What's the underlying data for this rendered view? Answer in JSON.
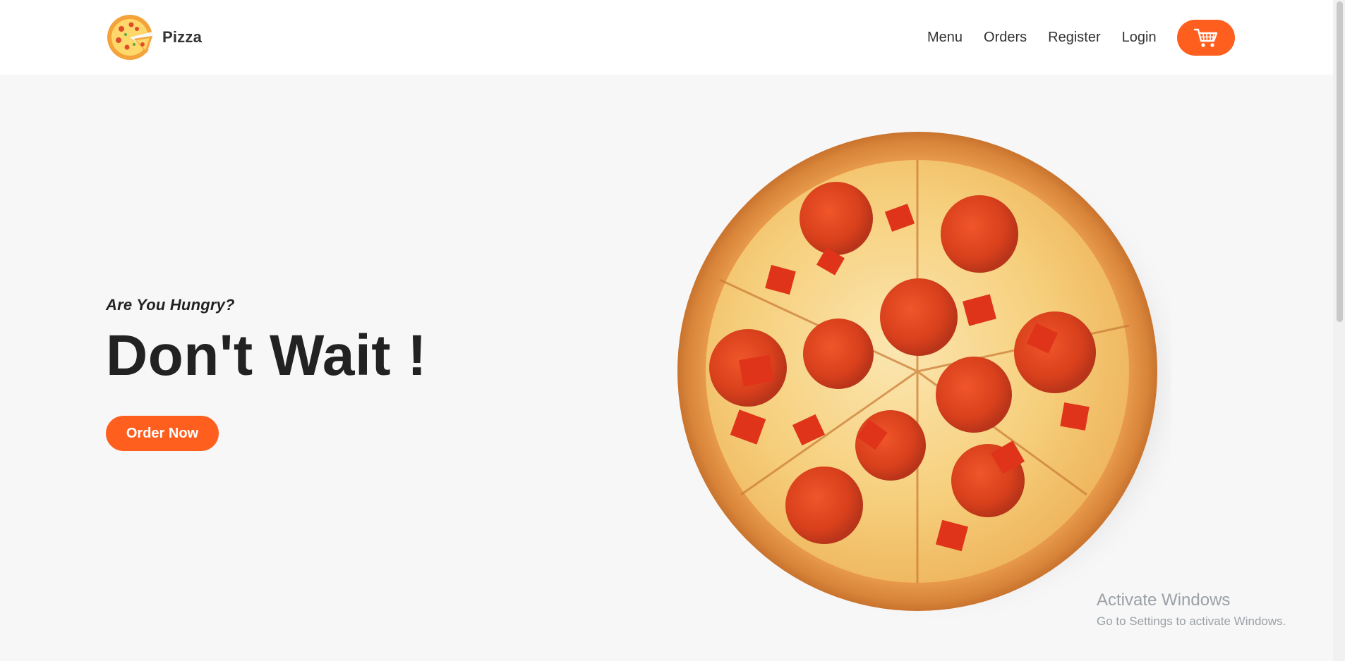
{
  "brand": {
    "name": "Pizza",
    "logo_icon": "pizza-slice-logo-icon"
  },
  "nav": {
    "items": [
      {
        "label": "Menu"
      },
      {
        "label": "Orders"
      },
      {
        "label": "Register"
      },
      {
        "label": "Login"
      }
    ],
    "cart_icon": "shopping-cart-icon"
  },
  "hero": {
    "tagline": "Are You Hungry?",
    "headline": "Don't Wait !",
    "cta_label": "Order Now",
    "image_icon": "pepperoni-pizza-image"
  },
  "watermark": {
    "title": "Activate Windows",
    "subtitle": "Go to Settings to activate Windows."
  },
  "colors": {
    "accent": "#fe5f1e",
    "page_background": "#f7f7f7",
    "header_background": "#ffffff",
    "text": "#222222"
  }
}
